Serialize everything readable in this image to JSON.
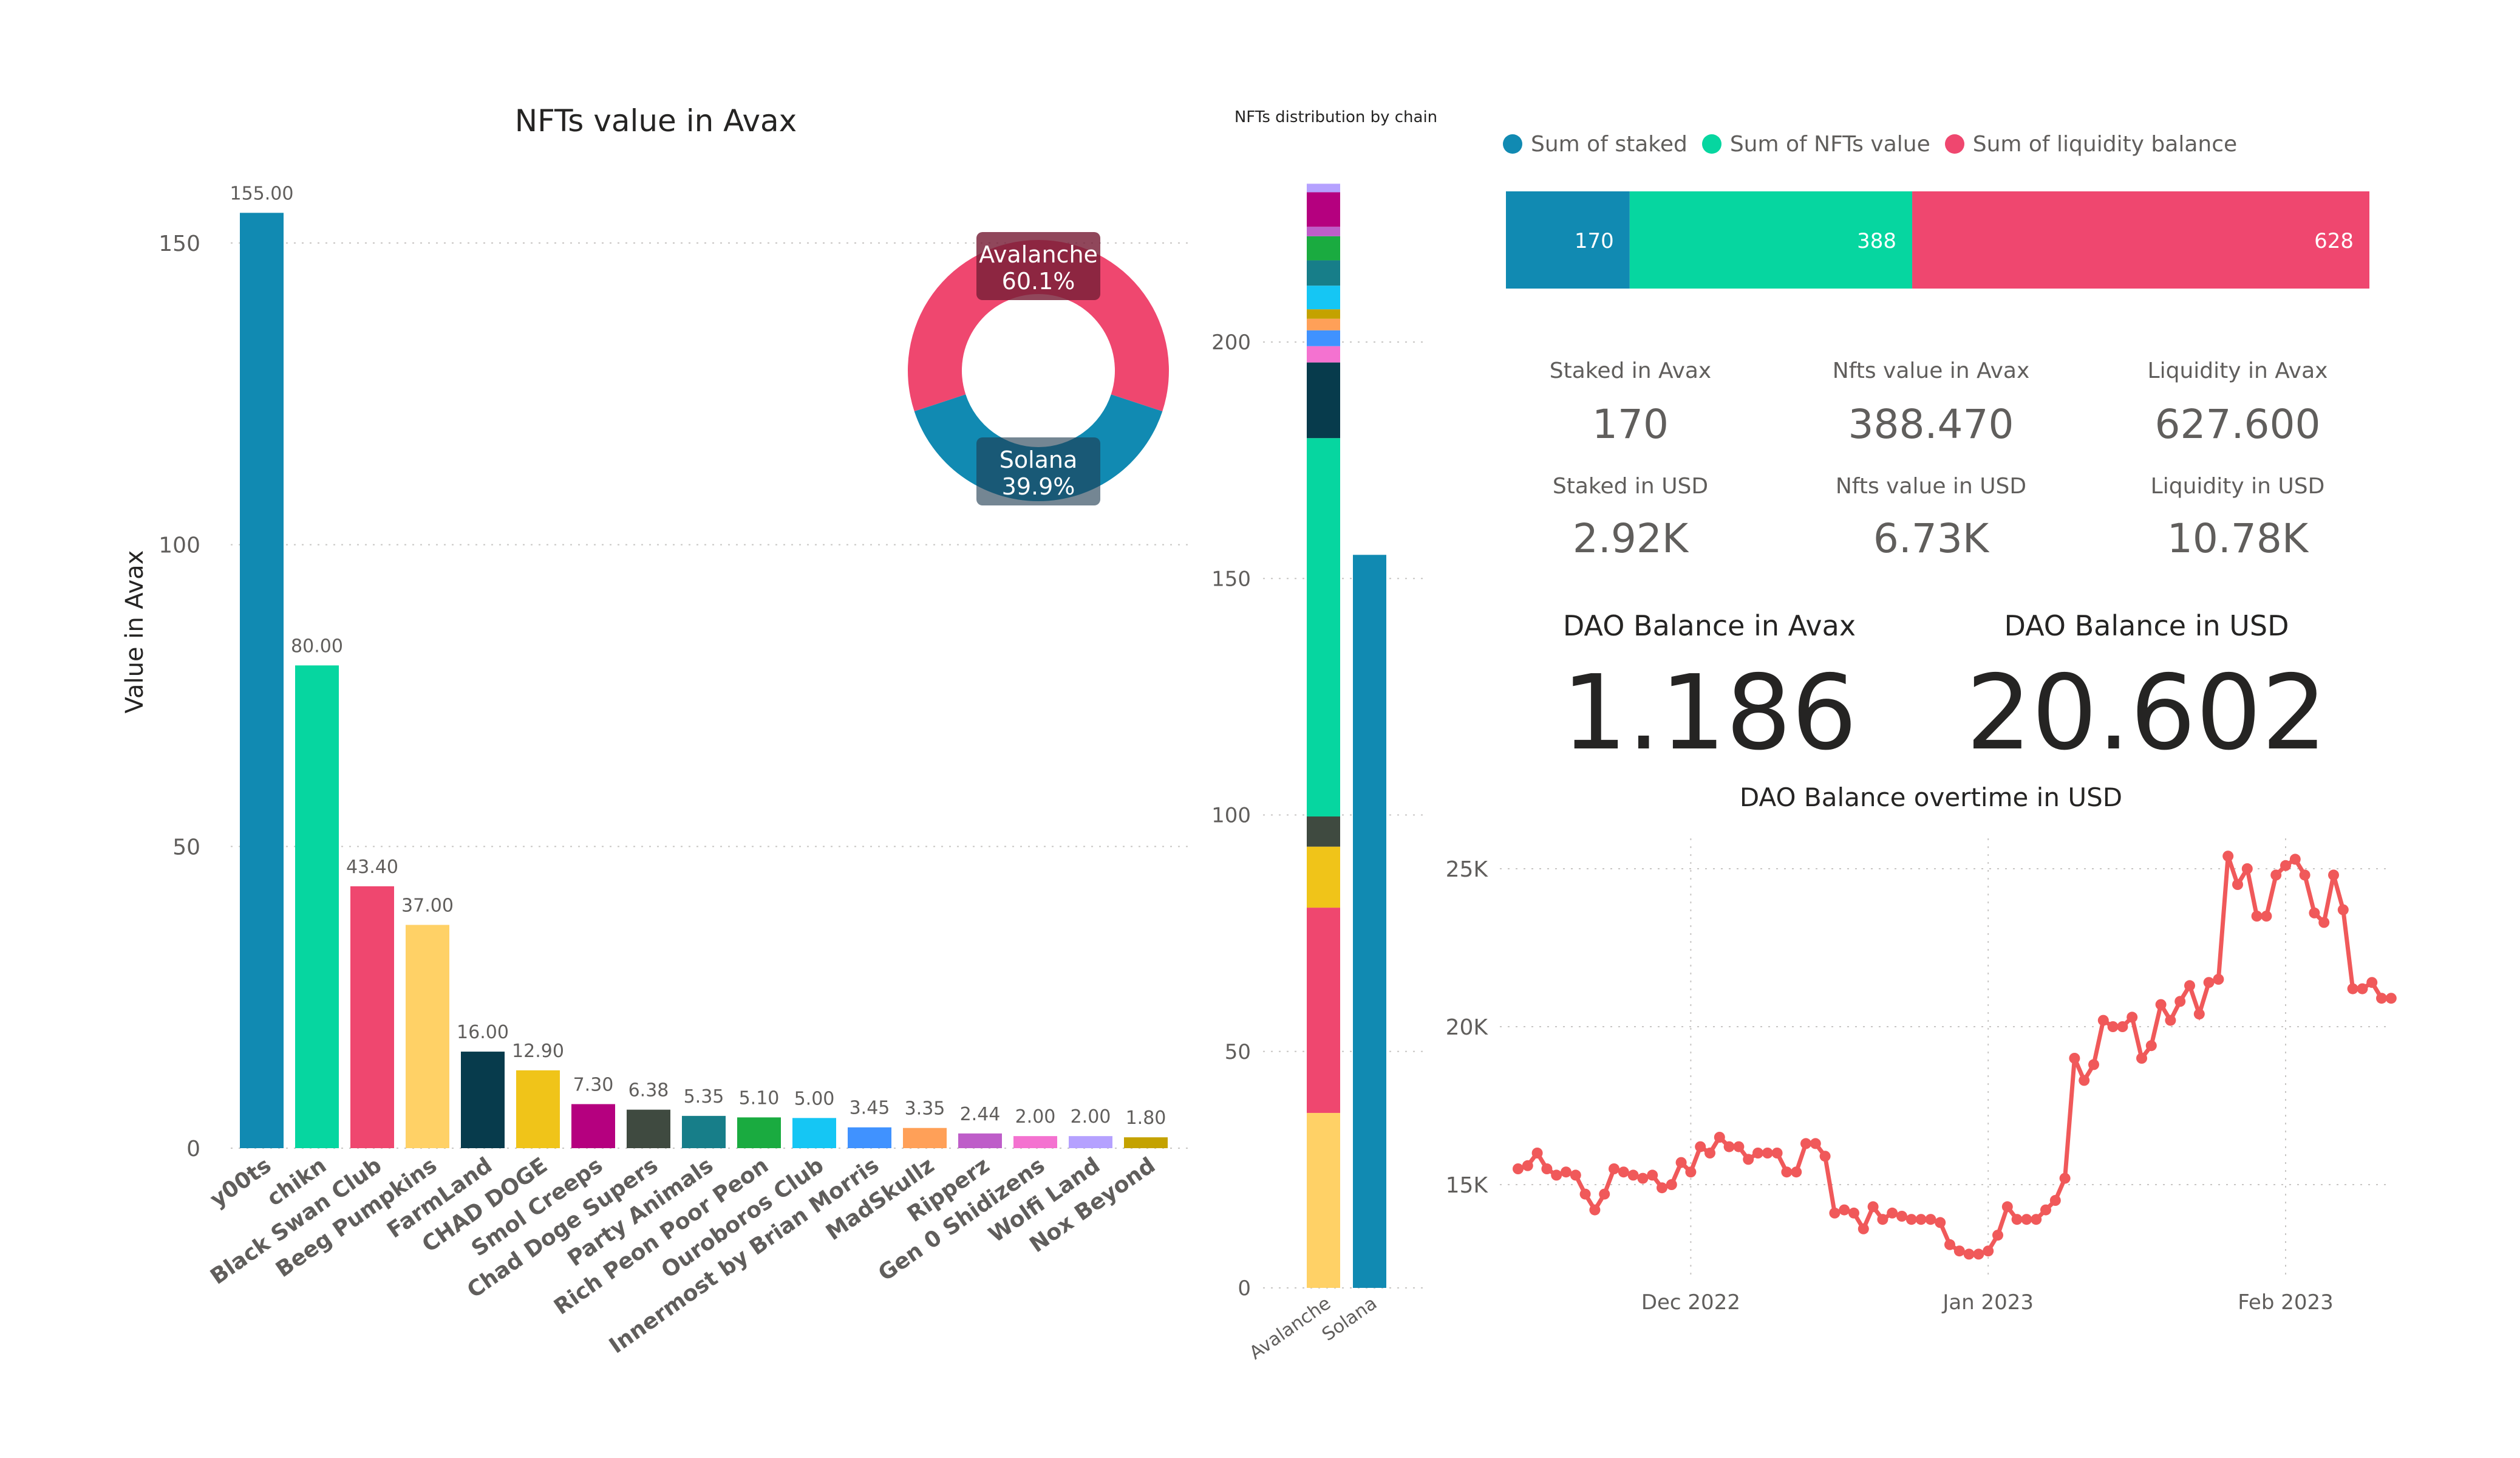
{
  "colors": {
    "palette": [
      "#118dff",
      "#12239e",
      "#e66c37",
      "#6b007b",
      "#e044a7"
    ],
    "blue": "#118AB2",
    "green": "#06D6A0",
    "red": "#EF476F",
    "yellow": "#FFD166",
    "navy": "#073B4C",
    "gold": "#F0C419",
    "magenta": "#B5007F",
    "darkgray": "#3F4A40",
    "teal": "#177E89",
    "kelly": "#1AAB40",
    "sky": "#15C6F4",
    "azure": "#4092FF",
    "orange": "#FFA058",
    "purple": "#BE5DC9",
    "pink": "#F472D0",
    "lavender": "#B5A1FF",
    "olive": "#C4A200",
    "line": "#F0595A",
    "gridline": "#c8c6c4"
  },
  "chart_data": [
    {
      "type": "bar",
      "title": "NFTs value in Avax",
      "ylabel": "Value in Avax",
      "xlabel": "",
      "ylim": [
        0,
        160
      ],
      "yticks": [
        "0",
        "50",
        "100",
        "150"
      ],
      "categories": [
        "y00ts",
        "chikn",
        "Black Swan Club",
        "Beeg Pumpkins",
        "FarmLand",
        "CHAD DOGE",
        "Smol Creeps",
        "Chad Doge Supers",
        "Party Animals",
        "Rich Peon Poor Peon",
        "Ouroboros Club",
        "Innermost by Brian Morris",
        "MadSkullz",
        "Ripperz",
        "Gen 0 Shidizens",
        "Wolfi Land",
        "Nox Beyond"
      ],
      "values": [
        155.0,
        80.0,
        43.4,
        37.0,
        16.0,
        12.9,
        7.3,
        6.38,
        5.35,
        5.1,
        5.0,
        3.45,
        3.35,
        2.44,
        2.0,
        2.0,
        1.8
      ],
      "data_labels": [
        "155.00",
        "80.00",
        "43.40",
        "37.00",
        "16.00",
        "12.90",
        "7.30",
        "6.38",
        "5.35",
        "5.10",
        "5.00",
        "3.45",
        "3.35",
        "2.44",
        "2.00",
        "2.00",
        "1.80"
      ],
      "bar_colors": [
        "#118AB2",
        "#06D6A0",
        "#EF476F",
        "#FFD166",
        "#073B4C",
        "#F0C419",
        "#B5007F",
        "#3F4A40",
        "#177E89",
        "#1AAB40",
        "#15C6F4",
        "#4092FF",
        "#FFA058",
        "#BE5DC9",
        "#F472D0",
        "#B5A1FF",
        "#C4A200"
      ],
      "grid": true
    },
    {
      "type": "pie",
      "variant": "donut",
      "slices": [
        {
          "label": "Avalanche",
          "percent_label": "60.1%",
          "value": 60.1,
          "color": "#EF476F"
        },
        {
          "label": "Solana",
          "percent_label": "39.9%",
          "value": 39.9,
          "color": "#118AB2"
        }
      ]
    },
    {
      "type": "bar",
      "variant": "stacked",
      "title": "NFTs distribution by chain",
      "categories": [
        "Avalanche",
        "Solana"
      ],
      "ylim": [
        0,
        235
      ],
      "yticks": [
        "0",
        "50",
        "100",
        "150",
        "200"
      ],
      "series": [
        {
          "values": [
            37.0,
            0
          ],
          "color": "#FFD166"
        },
        {
          "values": [
            43.4,
            0
          ],
          "color": "#EF476F"
        },
        {
          "values": [
            12.9,
            0
          ],
          "color": "#F0C419"
        },
        {
          "values": [
            6.38,
            0
          ],
          "color": "#3F4A40"
        },
        {
          "values": [
            80.0,
            0
          ],
          "color": "#06D6A0"
        },
        {
          "values": [
            16.0,
            0
          ],
          "color": "#073B4C"
        },
        {
          "values": [
            3.45,
            0
          ],
          "color": "#F472D0"
        },
        {
          "values": [
            3.35,
            0
          ],
          "color": "#4092FF"
        },
        {
          "values": [
            2.44,
            0
          ],
          "color": "#FFA058"
        },
        {
          "values": [
            2.0,
            0
          ],
          "color": "#C4A200"
        },
        {
          "values": [
            5.0,
            0
          ],
          "color": "#15C6F4"
        },
        {
          "values": [
            5.35,
            0
          ],
          "color": "#177E89"
        },
        {
          "values": [
            5.1,
            0
          ],
          "color": "#1AAB40"
        },
        {
          "values": [
            2.0,
            0
          ],
          "color": "#BE5DC9"
        },
        {
          "values": [
            7.3,
            0
          ],
          "color": "#B5007F"
        },
        {
          "values": [
            1.8,
            0
          ],
          "color": "#B5A1FF"
        },
        {
          "values": [
            0,
            155.0
          ],
          "color": "#118AB2"
        }
      ],
      "grid": true
    },
    {
      "type": "bar",
      "variant": "100% stacked horizontal",
      "legend_position": "top-left",
      "series": [
        {
          "name": "Sum of staked",
          "value": 170,
          "label": "170",
          "color": "#118AB2"
        },
        {
          "name": "Sum of NFTs value",
          "value": 388,
          "label": "388",
          "color": "#06D6A0"
        },
        {
          "name": "Sum of liquidity balance",
          "value": 628,
          "label": "628",
          "color": "#EF476F"
        }
      ],
      "total_label": "1186"
    },
    {
      "type": "line",
      "title": "DAO Balance overtime in USD",
      "x_tick_labels": [
        "Dec 2022",
        "Jan 2023",
        "Feb 2023"
      ],
      "x_tick_dates": [
        "2022-12-01",
        "2023-01-01",
        "2023-02-01"
      ],
      "y_tick_labels": [
        "15K",
        "20K",
        "25K"
      ],
      "y_tick_values": [
        15000,
        20000,
        25000
      ],
      "ylim": [
        12000,
        26300
      ],
      "x": [
        "2022-11-13",
        "2022-11-14",
        "2022-11-15",
        "2022-11-16",
        "2022-11-17",
        "2022-11-18",
        "2022-11-19",
        "2022-11-20",
        "2022-11-21",
        "2022-11-22",
        "2022-11-23",
        "2022-11-24",
        "2022-11-25",
        "2022-11-26",
        "2022-11-27",
        "2022-11-28",
        "2022-11-29",
        "2022-11-30",
        "2022-12-01",
        "2022-12-02",
        "2022-12-03",
        "2022-12-04",
        "2022-12-05",
        "2022-12-06",
        "2022-12-07",
        "2022-12-08",
        "2022-12-09",
        "2022-12-10",
        "2022-12-11",
        "2022-12-12",
        "2022-12-13",
        "2022-12-14",
        "2022-12-15",
        "2022-12-16",
        "2022-12-17",
        "2022-12-18",
        "2022-12-19",
        "2022-12-20",
        "2022-12-21",
        "2022-12-22",
        "2022-12-23",
        "2022-12-24",
        "2022-12-25",
        "2022-12-26",
        "2022-12-27",
        "2022-12-28",
        "2022-12-29",
        "2022-12-30",
        "2022-12-31",
        "2023-01-01",
        "2023-01-02",
        "2023-01-03",
        "2023-01-04",
        "2023-01-05",
        "2023-01-06",
        "2023-01-07",
        "2023-01-08",
        "2023-01-09",
        "2023-01-10",
        "2023-01-11",
        "2023-01-12",
        "2023-01-13",
        "2023-01-14",
        "2023-01-15",
        "2023-01-16",
        "2023-01-17",
        "2023-01-18",
        "2023-01-19",
        "2023-01-20",
        "2023-01-21",
        "2023-01-22",
        "2023-01-23",
        "2023-01-24",
        "2023-01-25",
        "2023-01-26",
        "2023-01-27",
        "2023-01-28",
        "2023-01-29",
        "2023-01-30",
        "2023-01-31",
        "2023-02-01",
        "2023-02-02",
        "2023-02-03",
        "2023-02-04",
        "2023-02-05",
        "2023-02-06",
        "2023-02-07",
        "2023-02-08",
        "2023-02-09",
        "2023-02-10",
        "2023-02-11",
        "2023-02-12"
      ],
      "y": [
        15500,
        15600,
        16000,
        15500,
        15300,
        15400,
        15300,
        14700,
        14200,
        14700,
        15500,
        15400,
        15300,
        15200,
        15300,
        14900,
        15000,
        15700,
        15400,
        16200,
        16000,
        16500,
        16200,
        16200,
        15800,
        16000,
        16000,
        16000,
        15400,
        15400,
        16300,
        16300,
        15900,
        14100,
        14200,
        14100,
        13600,
        14300,
        13900,
        14100,
        14000,
        13900,
        13900,
        13900,
        13800,
        13100,
        12900,
        12800,
        12800,
        12900,
        13400,
        14300,
        13900,
        13900,
        13900,
        14200,
        14500,
        15200,
        19000,
        18300,
        18800,
        20200,
        20000,
        20000,
        20300,
        19000,
        19400,
        20700,
        20200,
        20800,
        21300,
        20400,
        21400,
        21500,
        25400,
        24500,
        25000,
        23500,
        23500,
        24800,
        25100,
        25300,
        24800,
        23600,
        23300,
        24800,
        23700,
        21200,
        21200,
        21400,
        20900,
        20900
      ],
      "grid": true
    }
  ],
  "kpis": {
    "staked_avax_label": "Staked in Avax",
    "staked_avax_value": "170",
    "nfts_avax_label": "Nfts value in Avax",
    "nfts_avax_value": "388.470",
    "liquidity_avax_label": "Liquidity in Avax",
    "liquidity_avax_value": "627.600",
    "staked_usd_label": "Staked in USD",
    "staked_usd_value": "2.92K",
    "nfts_usd_label": "Nfts value in USD",
    "nfts_usd_value": "6.73K",
    "liquidity_usd_label": "Liquidity in USD",
    "liquidity_usd_value": "10.78K"
  },
  "dao": {
    "avax_label": "DAO Balance in Avax",
    "avax_value": "1.186",
    "usd_label": "DAO Balance in USD",
    "usd_value": "20.602"
  }
}
